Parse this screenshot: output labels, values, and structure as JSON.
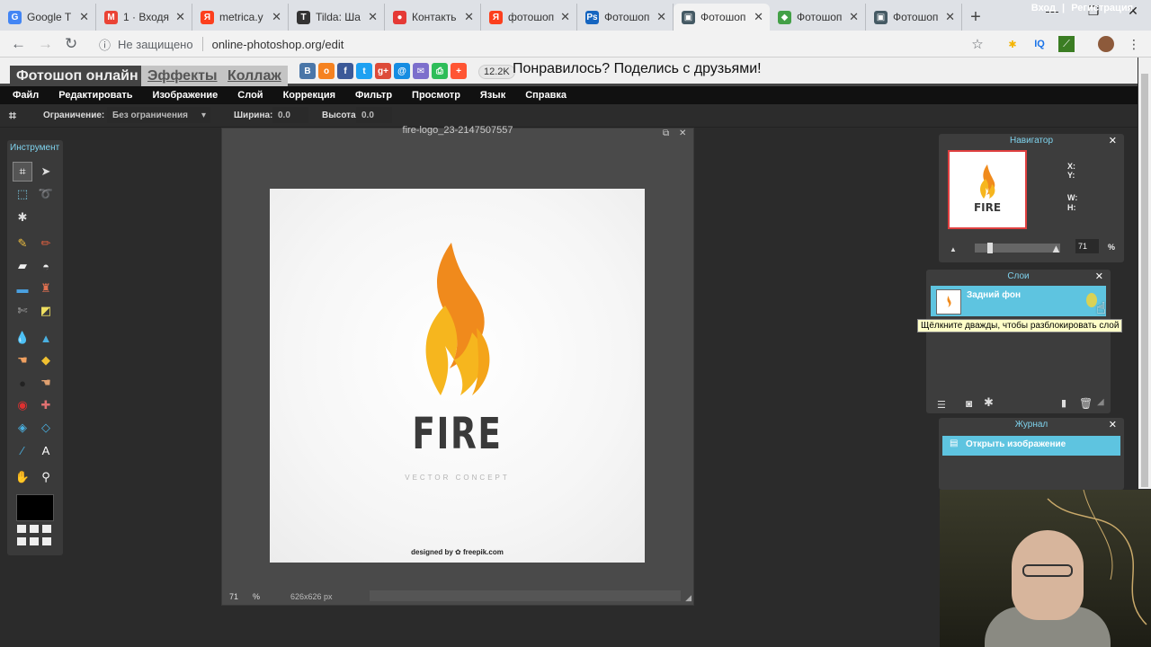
{
  "browser": {
    "tabs": [
      {
        "title": "Google T",
        "color": "#4285f4",
        "glyph": "G"
      },
      {
        "title": "1 · Входя",
        "color": "#ea4335",
        "glyph": "M"
      },
      {
        "title": "metrica.y",
        "color": "#fc3f1d",
        "glyph": "Я"
      },
      {
        "title": "Tilda: Ша",
        "color": "#333333",
        "glyph": "T"
      },
      {
        "title": "Контакть",
        "color": "#e53935",
        "glyph": "●"
      },
      {
        "title": "фотошоп",
        "color": "#fc3f1d",
        "glyph": "Я"
      },
      {
        "title": "Фотошоп",
        "color": "#1565c0",
        "glyph": "Ps"
      },
      {
        "title": "Фотошоп",
        "color": "#455a64",
        "glyph": "▣",
        "active": true
      },
      {
        "title": "Фотошоп",
        "color": "#43a047",
        "glyph": "◆"
      },
      {
        "title": "Фотошоп",
        "color": "#455a64",
        "glyph": "▣"
      }
    ],
    "not_secure": "Не защищено",
    "url": "online-photoshop.org/edit",
    "ext_iq": "IQ"
  },
  "site": {
    "tabs": [
      "Фотошоп онлайн",
      "Эффекты",
      "Коллаж"
    ],
    "share_count": "12.2K",
    "share_text": "Понравилось? Поделись с друзьями!",
    "social": [
      {
        "glyph": "B",
        "color": "#4a76a8"
      },
      {
        "glyph": "o",
        "color": "#f58220"
      },
      {
        "glyph": "f",
        "color": "#3b5998"
      },
      {
        "glyph": "t",
        "color": "#1da1f2"
      },
      {
        "glyph": "g+",
        "color": "#dd4b39"
      },
      {
        "glyph": "@",
        "color": "#168de2"
      },
      {
        "glyph": "✉",
        "color": "#7c6fcc"
      },
      {
        "glyph": "⎙",
        "color": "#2ebd59"
      },
      {
        "glyph": "+",
        "color": "#ff5533"
      }
    ]
  },
  "menu": {
    "items": [
      "Файл",
      "Редактировать",
      "Изображение",
      "Слой",
      "Коррекция",
      "Фильтр",
      "Просмотр",
      "Язык",
      "Справка"
    ],
    "login": "Вход",
    "register": "Регистрация"
  },
  "options": {
    "constraint_label": "Ограничение:",
    "constraint_value": "Без ограничения",
    "width_label": "Ширина:",
    "width_value": "0.0",
    "height_label": "Высота:",
    "height_value": "0.0"
  },
  "tools": {
    "title": "Инструмент"
  },
  "document": {
    "title": "fire-logo_23-2147507557",
    "logo_text": "FIRE",
    "logo_sub": "VECTOR CONCEPT",
    "credit": "designed by ✿ freepik.com",
    "zoom": "71",
    "zoom_unit": "%",
    "dims": "626x626 px",
    "colors": {
      "flame_orange": "#f08a1c",
      "flame_yellow": "#f6b61e"
    }
  },
  "navigator": {
    "title": "Навигатор",
    "x": "X:",
    "y": "Y:",
    "w": "W:",
    "h": "H:",
    "zoom": "71",
    "unit": "%",
    "thumb_text": "FIRE"
  },
  "layers": {
    "title": "Слои",
    "layer_name": "Задний фон",
    "tooltip": "Щёлкните дважды, чтобы разблокировать слой"
  },
  "history": {
    "title": "Журнал",
    "item": "Открыть изображение"
  }
}
